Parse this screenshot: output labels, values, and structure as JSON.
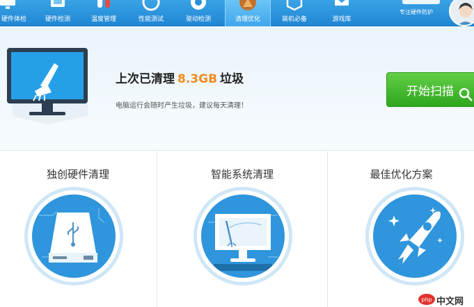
{
  "nav": {
    "tabs": [
      {
        "label": "硬件体检",
        "icon": "monitor-icon"
      },
      {
        "label": "硬件检测",
        "icon": "hardware-icon"
      },
      {
        "label": "温度管理",
        "icon": "temperature-icon"
      },
      {
        "label": "性能测试",
        "icon": "speedometer-icon"
      },
      {
        "label": "驱动检测",
        "icon": "driver-icon"
      },
      {
        "label": "清理优化",
        "icon": "broom-icon"
      },
      {
        "label": "装机必备",
        "icon": "box-icon"
      },
      {
        "label": "游戏库",
        "icon": "game-icon"
      }
    ],
    "active_tab": "清理优化",
    "brand_slogan": "专注硬件防护"
  },
  "hero": {
    "last_clean_prefix": "上次已清理",
    "last_clean_amount": "8.3GB",
    "last_clean_suffix": "垃圾",
    "hint": "电脑运行会随时产生垃圾，建议每天清理！",
    "scan_button": "开始扫描"
  },
  "features": [
    {
      "title": "独创硬件清理",
      "icon": "hard-drive-icon"
    },
    {
      "title": "智能系统清理",
      "icon": "monitor-clean-icon"
    },
    {
      "title": "最佳优化方案",
      "icon": "rocket-icon"
    }
  ],
  "watermark": {
    "text": "中文网"
  },
  "colors": {
    "accent": "#2f95dc",
    "amount": "#f28a1d",
    "scan_button": "#3cb52a"
  }
}
